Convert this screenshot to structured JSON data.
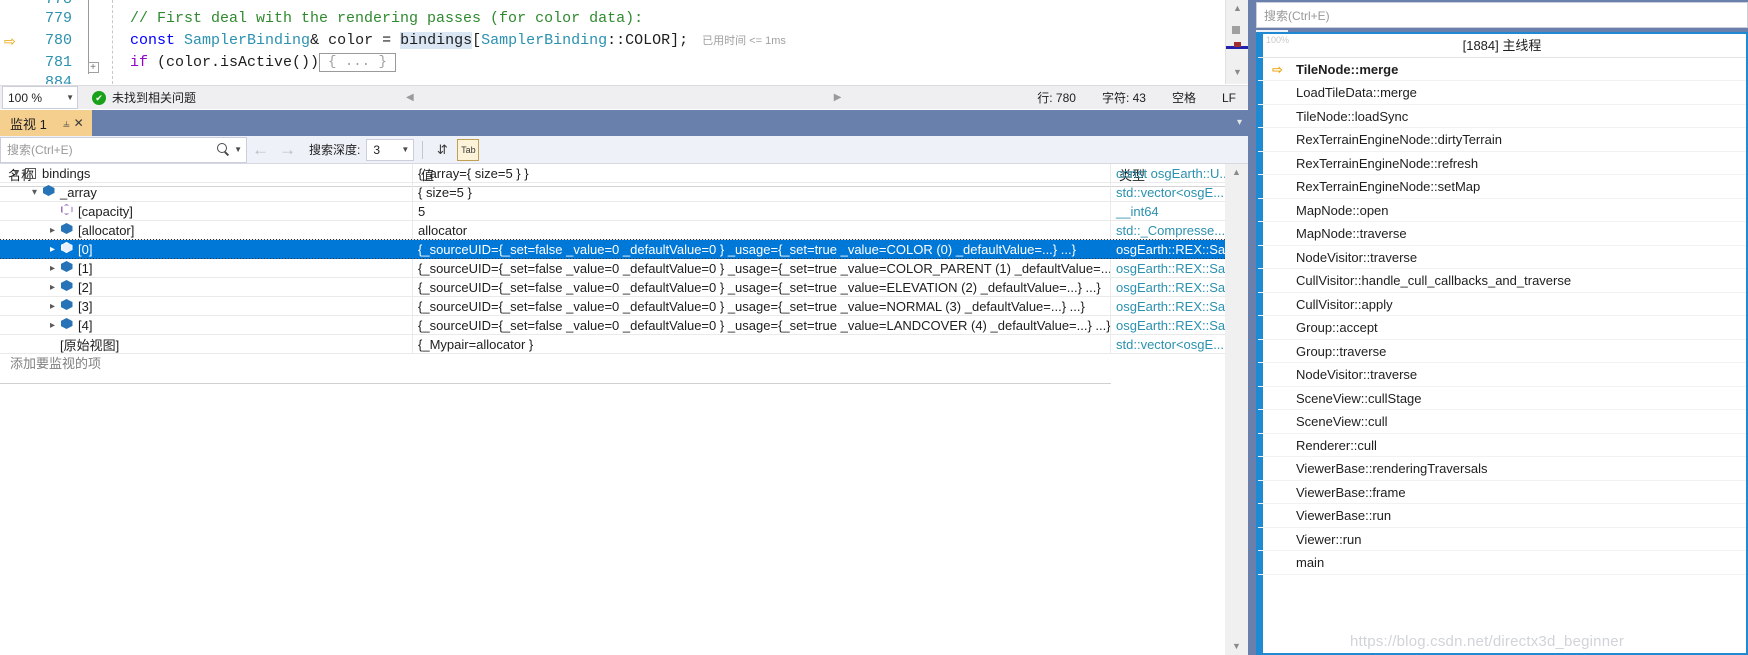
{
  "editor": {
    "lines": [
      {
        "num": "778",
        "partial": true
      },
      {
        "num": "779",
        "code_comment": "// First deal with the rendering passes (for color data):"
      },
      {
        "num": "780"
      },
      {
        "num": "781"
      },
      {
        "num": "884",
        "partial": true
      }
    ],
    "line780": {
      "kw_const": "const",
      "type_name": "SamplerBinding",
      "amp_color": "& color = ",
      "sel_bindings": "bindings",
      "bracket_open": "[",
      "inner_type": "SamplerBinding",
      "colons_color": "::COLOR",
      "bracket_close": "];",
      "elapsed": "已用时间 <= 1ms"
    },
    "line781": {
      "kw_if": "if",
      "cond": " (color.isActive())",
      "collapsed": "{ ... }"
    },
    "fold_glyph": "+",
    "current_line_marker": "⇨"
  },
  "editor_status": {
    "zoom": "100 %",
    "problems": "未找到相关问题",
    "ok_glyph": "✔",
    "line_label": "行: 780",
    "char_label": "字符: 43",
    "spaces_label": "空格",
    "eol_label": "LF",
    "nav_left_glyph": "◀",
    "nav_right_glyph": "▶"
  },
  "watch": {
    "tab_name": "监视 1",
    "pin_glyph": "⫨",
    "close_glyph": "✕",
    "tabstrip_caret": "▾",
    "search_placeholder": "搜索(Ctrl+E)",
    "depth_label": "搜索深度:",
    "depth_value": "3",
    "toolbar_buttons": [
      {
        "name": "compare-columns-button",
        "glyph": "⇵"
      },
      {
        "name": "hex-display-button",
        "glyph": "Tab"
      }
    ],
    "columns": {
      "name": "名称",
      "value": "值",
      "type": "类型"
    },
    "rows": [
      {
        "indent": 0,
        "expander": "down",
        "icon": "struct-box",
        "name": "bindings",
        "value": "{_array={ size=5 } }",
        "type": "const osgEarth::U...",
        "selected": false
      },
      {
        "indent": 1,
        "expander": "down",
        "icon": "field-blue",
        "name": "_array",
        "value": "{ size=5 }",
        "type": "std::vector<osgE...",
        "selected": false
      },
      {
        "indent": 2,
        "expander": "none",
        "icon": "field-purple-outline",
        "name": "[capacity]",
        "value": "5",
        "type": "__int64",
        "selected": false
      },
      {
        "indent": 2,
        "expander": "right",
        "icon": "field-blue",
        "name": "[allocator]",
        "value": "allocator",
        "type": "std::_Compresse...",
        "selected": false
      },
      {
        "indent": 2,
        "expander": "right",
        "icon": "field-white-outline",
        "name": "[0]",
        "value": "{_sourceUID={_set=false _value=0 _defaultValue=0 } _usage={_set=true _value=COLOR (0) _defaultValue=...} ...}",
        "type": "osgEarth::REX::Sa...",
        "selected": true
      },
      {
        "indent": 2,
        "expander": "right",
        "icon": "field-blue",
        "name": "[1]",
        "value": "{_sourceUID={_set=false _value=0 _defaultValue=0 } _usage={_set=true _value=COLOR_PARENT (1) _defaultValue=......",
        "type": "osgEarth::REX::Sa...",
        "selected": false
      },
      {
        "indent": 2,
        "expander": "right",
        "icon": "field-blue",
        "name": "[2]",
        "value": "{_sourceUID={_set=false _value=0 _defaultValue=0 } _usage={_set=true _value=ELEVATION (2) _defaultValue=...} ...}",
        "type": "osgEarth::REX::Sa...",
        "selected": false
      },
      {
        "indent": 2,
        "expander": "right",
        "icon": "field-blue",
        "name": "[3]",
        "value": "{_sourceUID={_set=false _value=0 _defaultValue=0 } _usage={_set=true _value=NORMAL (3) _defaultValue=...} ...}",
        "type": "osgEarth::REX::Sa...",
        "selected": false
      },
      {
        "indent": 2,
        "expander": "right",
        "icon": "field-blue",
        "name": "[4]",
        "value": "{_sourceUID={_set=false _value=0 _defaultValue=0 } _usage={_set=true _value=LANDCOVER (4) _defaultValue=...} ...}",
        "type": "osgEarth::REX::Sa...",
        "selected": false
      },
      {
        "indent": 1,
        "expander": "none",
        "icon": "none",
        "name": "[原始视图]",
        "value": "{_Mypair=allocator }",
        "type": "std::vector<osgE...",
        "selected": false
      }
    ],
    "add_item_placeholder": "添加要监视的项"
  },
  "callstack": {
    "search_placeholder": "搜索(Ctrl+E)",
    "coverage_label": "100%",
    "thread_header": "[1884] 主线程",
    "current_arrow": "⇨",
    "frames": [
      {
        "label": "TileNode::merge",
        "current": true
      },
      {
        "label": "LoadTileData::merge",
        "current": false
      },
      {
        "label": "TileNode::loadSync",
        "current": false
      },
      {
        "label": "RexTerrainEngineNode::dirtyTerrain",
        "current": false
      },
      {
        "label": "RexTerrainEngineNode::refresh",
        "current": false
      },
      {
        "label": "RexTerrainEngineNode::setMap",
        "current": false
      },
      {
        "label": "MapNode::open",
        "current": false
      },
      {
        "label": "MapNode::traverse",
        "current": false
      },
      {
        "label": "NodeVisitor::traverse",
        "current": false
      },
      {
        "label": "CullVisitor::handle_cull_callbacks_and_traverse",
        "current": false
      },
      {
        "label": "CullVisitor::apply",
        "current": false
      },
      {
        "label": "Group::accept",
        "current": false
      },
      {
        "label": "Group::traverse",
        "current": false
      },
      {
        "label": "NodeVisitor::traverse",
        "current": false
      },
      {
        "label": "SceneView::cullStage",
        "current": false
      },
      {
        "label": "SceneView::cull",
        "current": false
      },
      {
        "label": "Renderer::cull",
        "current": false
      },
      {
        "label": "ViewerBase::renderingTraversals",
        "current": false
      },
      {
        "label": "ViewerBase::frame",
        "current": false
      },
      {
        "label": "ViewerBase::run",
        "current": false
      },
      {
        "label": "Viewer::run",
        "current": false
      },
      {
        "label": "main",
        "current": false
      }
    ],
    "watermark": "https://blog.csdn.net/directx3d_beginner"
  }
}
